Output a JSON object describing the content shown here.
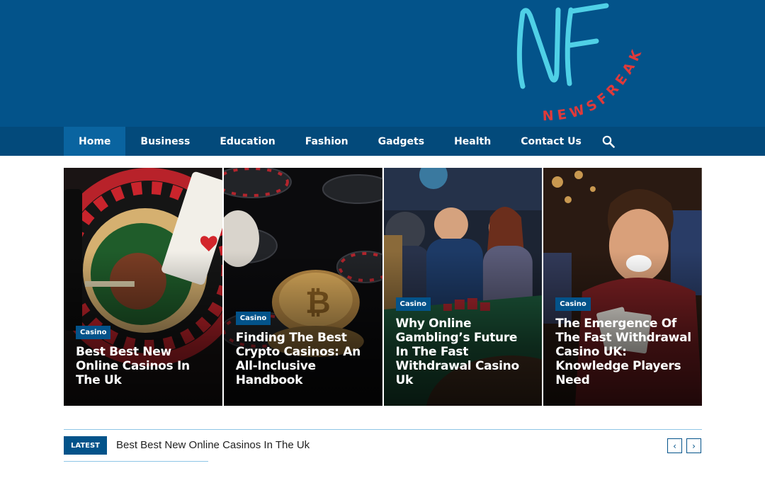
{
  "site": {
    "logo_text": "NF",
    "logo_tagline": "NEWSFREAK",
    "colors": {
      "header_bg": "#03538a",
      "nav_bg": "#034a7b",
      "nav_active": "#0a64a0",
      "logo_cyan": "#4fd0e6",
      "logo_red": "#e03a3a"
    }
  },
  "nav": {
    "items": [
      {
        "label": "Home",
        "active": true
      },
      {
        "label": "Business"
      },
      {
        "label": "Education"
      },
      {
        "label": "Fashion"
      },
      {
        "label": "Gadgets"
      },
      {
        "label": "Health"
      },
      {
        "label": "Contact Us"
      }
    ],
    "search_icon": "search-icon"
  },
  "featured": [
    {
      "category": "Casino",
      "title": "Best Best New Online Casinos In The Uk",
      "image": "roulette-wheel-cards"
    },
    {
      "category": "Casino",
      "title": "Finding The Best Crypto Casinos: An All-Inclusive Handbook",
      "image": "bitcoin-poker-chips"
    },
    {
      "category": "Casino",
      "title": "Why Online Gambling’s Future In The Fast Withdrawal Casino Uk",
      "image": "casino-table-players"
    },
    {
      "category": "Casino",
      "title": "The Emergence Of The Fast Withdrawal Casino UK: Knowledge Players Need",
      "image": "excited-card-player"
    }
  ],
  "ticker": {
    "label": "LATEST",
    "headline": "Best Best New Online Casinos In The Uk",
    "prev_icon": "chevron-left-icon",
    "next_icon": "chevron-right-icon",
    "prev_glyph": "‹",
    "next_glyph": "›"
  }
}
